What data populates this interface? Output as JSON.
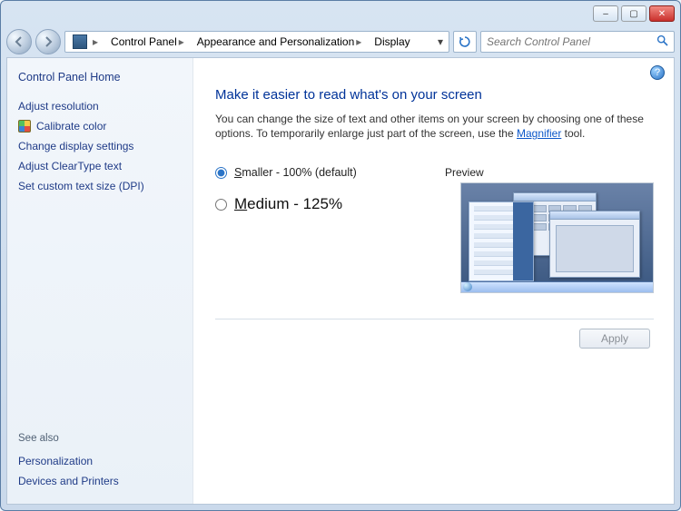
{
  "window_controls": {
    "minimize": "–",
    "maximize": "▢",
    "close": "✕"
  },
  "breadcrumb": {
    "item1": "Control Panel",
    "item2": "Appearance and Personalization",
    "item3": "Display"
  },
  "search": {
    "placeholder": "Search Control Panel"
  },
  "sidebar": {
    "home": "Control Panel Home",
    "links": {
      "adjust_resolution": "Adjust resolution",
      "calibrate_color": "Calibrate color",
      "change_display": "Change display settings",
      "cleartype": "Adjust ClearType text",
      "custom_dpi": "Set custom text size (DPI)"
    },
    "see_also_label": "See also",
    "see_also": {
      "personalization": "Personalization",
      "devices": "Devices and Printers"
    }
  },
  "content": {
    "title": "Make it easier to read what's on your screen",
    "desc_before": "You can change the size of text and other items on your screen by choosing one of these options. To temporarily enlarge just part of the screen, use the ",
    "magnifier": "Magnifier",
    "desc_after": " tool.",
    "radio_smaller_prefix": "S",
    "radio_smaller_rest": "maller - 100% (default)",
    "radio_medium_prefix": "M",
    "radio_medium_rest": "edium - 125%",
    "preview_label": "Preview",
    "apply": "Apply"
  }
}
